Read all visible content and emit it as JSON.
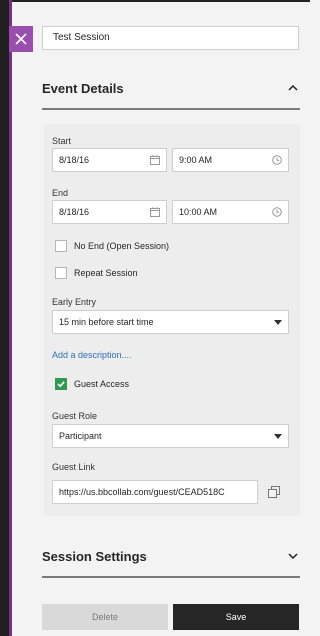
{
  "session": {
    "title_value": "Test Session"
  },
  "event_details": {
    "title": "Event Details",
    "start": {
      "label": "Start",
      "date": "8/18/16",
      "time": "9:00 AM"
    },
    "end": {
      "label": "End",
      "date": "8/18/16",
      "time": "10:00 AM"
    },
    "no_end_label": "No End (Open Session)",
    "repeat_label": "Repeat Session",
    "early_entry": {
      "label": "Early Entry",
      "value": "15 min before start time"
    },
    "add_description": "Add a description....",
    "guest_access_label": "Guest Access",
    "guest_role": {
      "label": "Guest Role",
      "value": "Participant"
    },
    "guest_link": {
      "label": "Guest Link",
      "value": "https://us.bbcollab.com/guest/CEAD518C"
    }
  },
  "session_settings": {
    "title": "Session Settings"
  },
  "actions": {
    "delete_label": "Delete",
    "save_label": "Save"
  },
  "colors": {
    "accent": "#9b4db0",
    "check": "#2e9b4e",
    "link": "#2e6fb7",
    "save_bg": "#262626"
  },
  "icons": [
    "close-icon",
    "chevron-up-icon",
    "calendar-icon",
    "clock-icon",
    "dropdown-arrow-icon",
    "copy-icon",
    "chevron-down-icon",
    "check-icon"
  ]
}
